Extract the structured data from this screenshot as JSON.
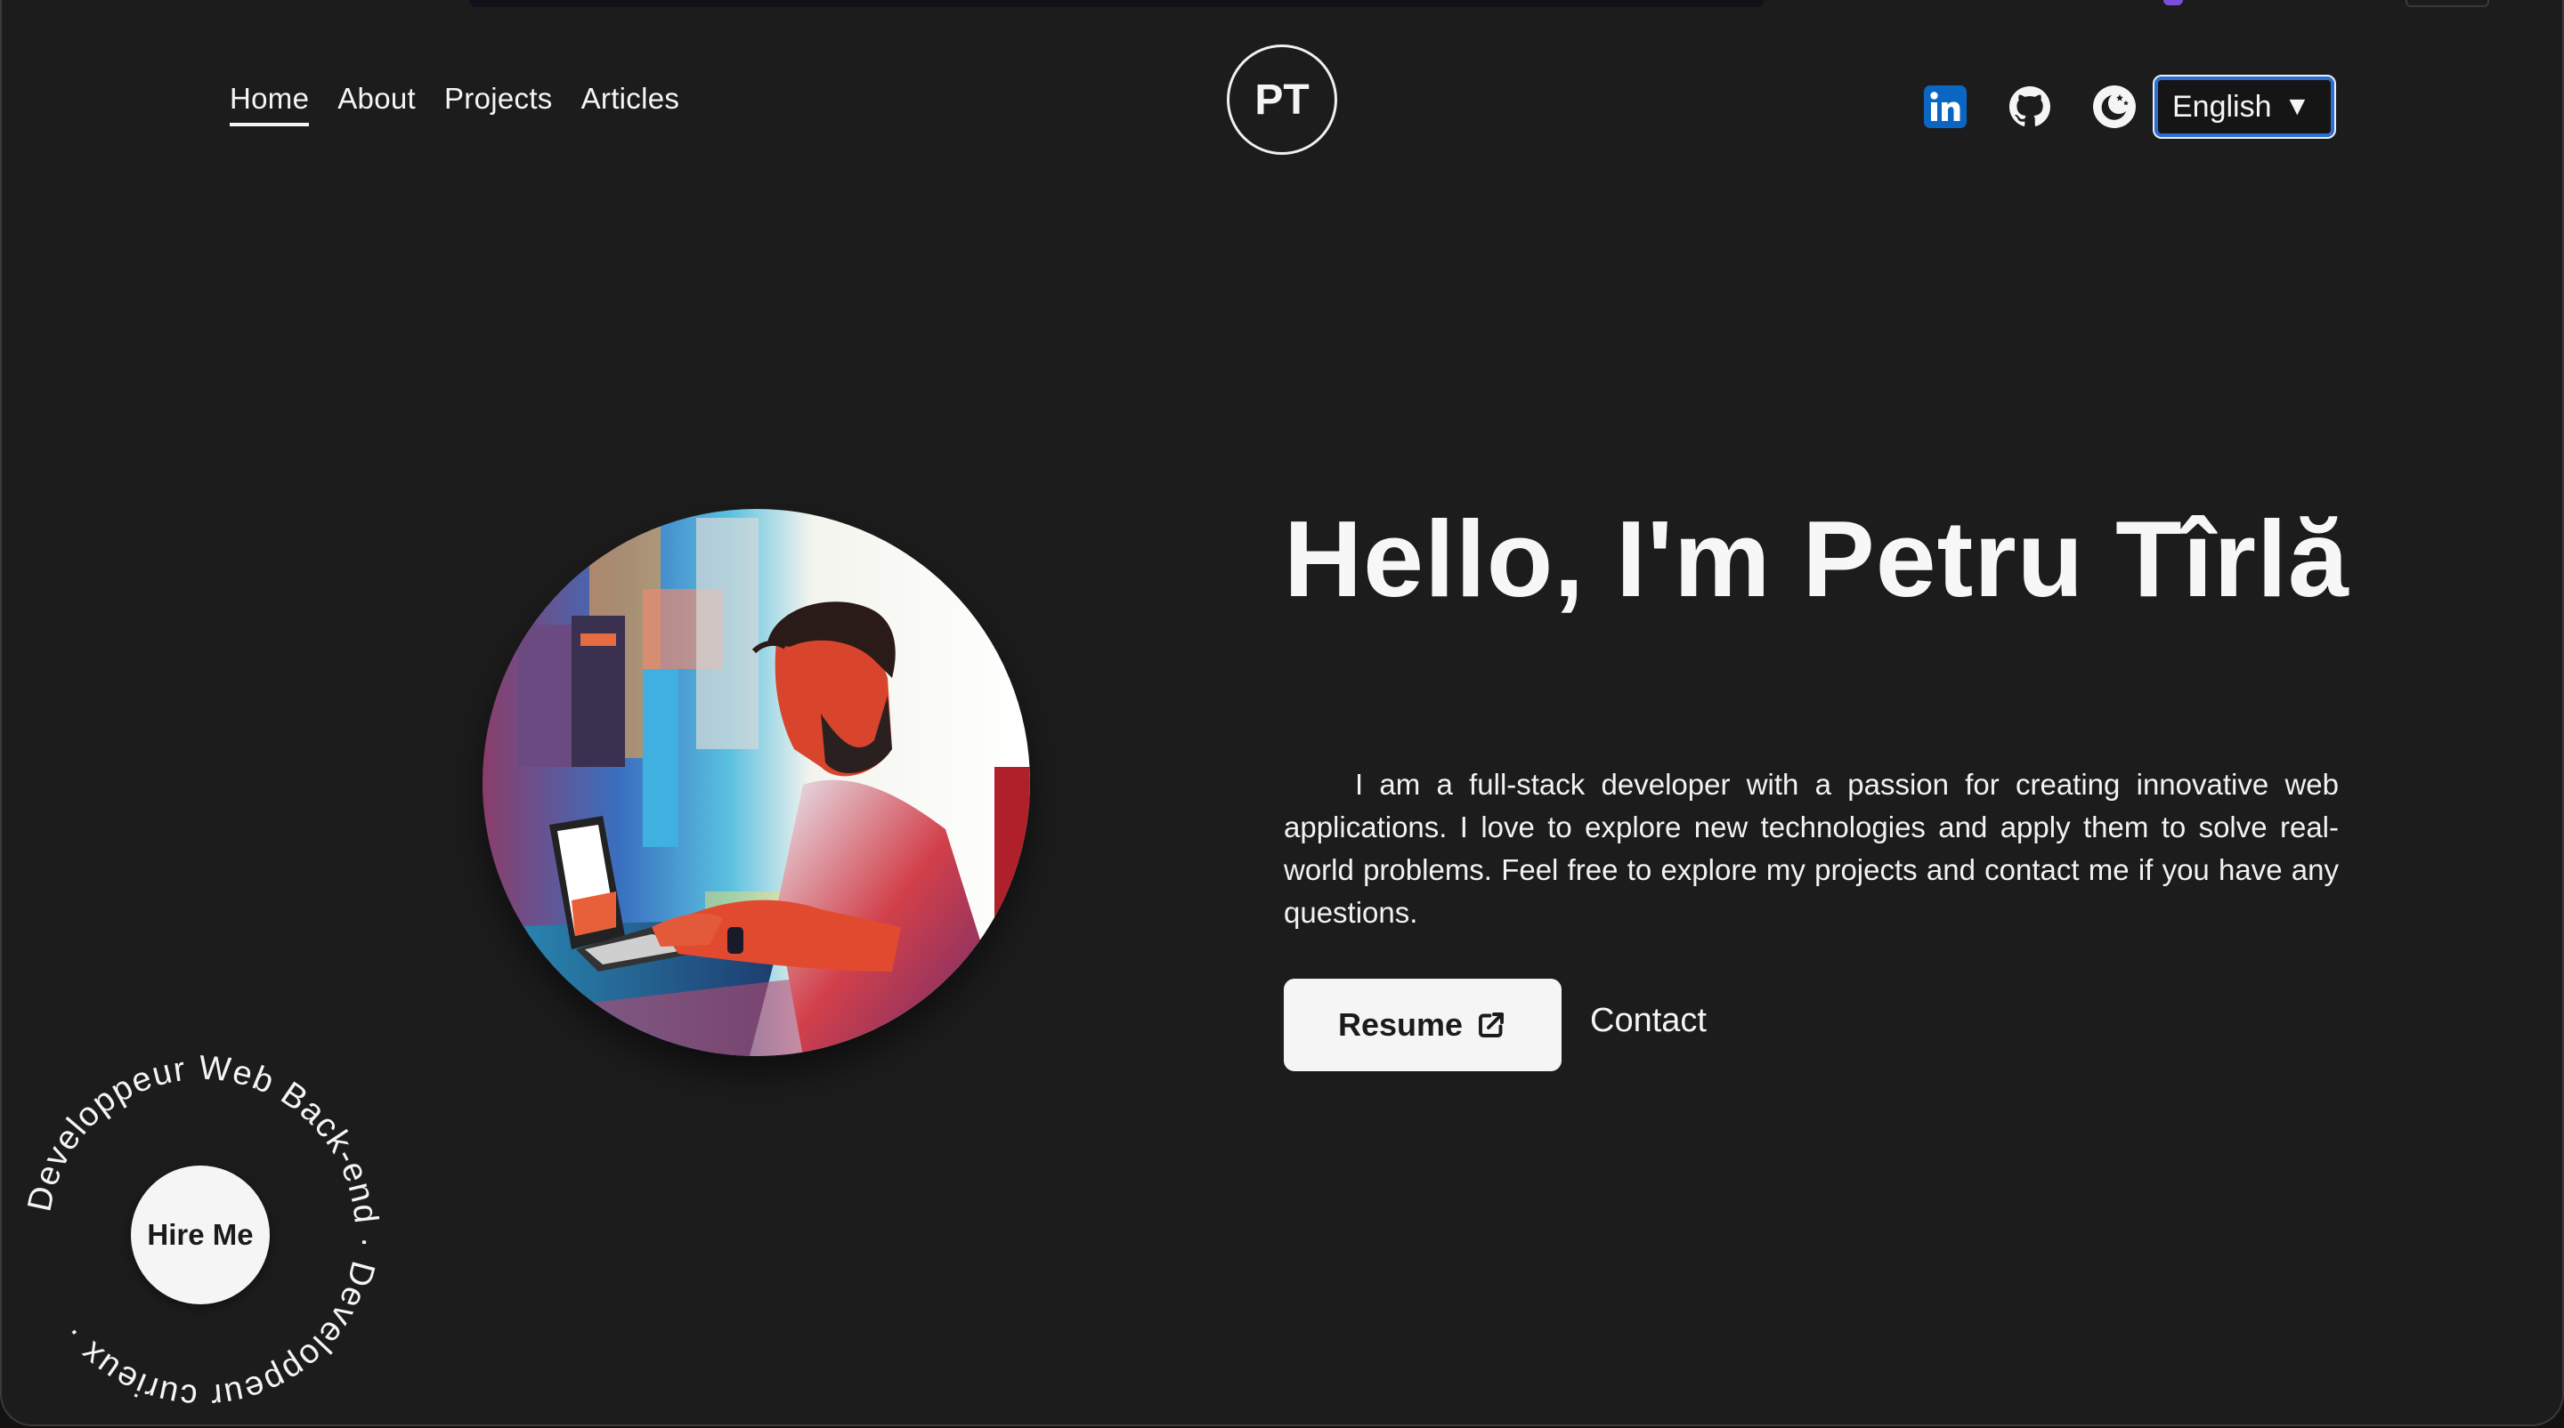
{
  "nav": {
    "links": [
      {
        "label": "Home",
        "active": true
      },
      {
        "label": "About",
        "active": false
      },
      {
        "label": "Projects",
        "active": false
      },
      {
        "label": "Articles",
        "active": false
      }
    ],
    "logo_text": "PT",
    "icons": [
      "linkedin-icon",
      "github-icon",
      "dark-mode-moon-icon"
    ],
    "language": {
      "selected": "English",
      "caret": "▼"
    }
  },
  "hero": {
    "title": "Hello, I'm Petru Tîrlă",
    "description": "I am a full-stack developer with a passion for creating innovative web applications. I love to explore new technologies and apply them to solve real-world problems. Feel free to explore my projects and contact me if you have any questions.",
    "resume_label": "Resume",
    "contact_label": "Contact"
  },
  "hire_badge": {
    "ring_text": "Developpeur Web Back-end · Developpeur curieux · ",
    "button_label": "Hire Me"
  },
  "colors": {
    "background": "#1c1c1c",
    "text": "#f5f5f5",
    "linkedin_blue": "#0a66c2",
    "select_border": "#2d6fd1"
  }
}
